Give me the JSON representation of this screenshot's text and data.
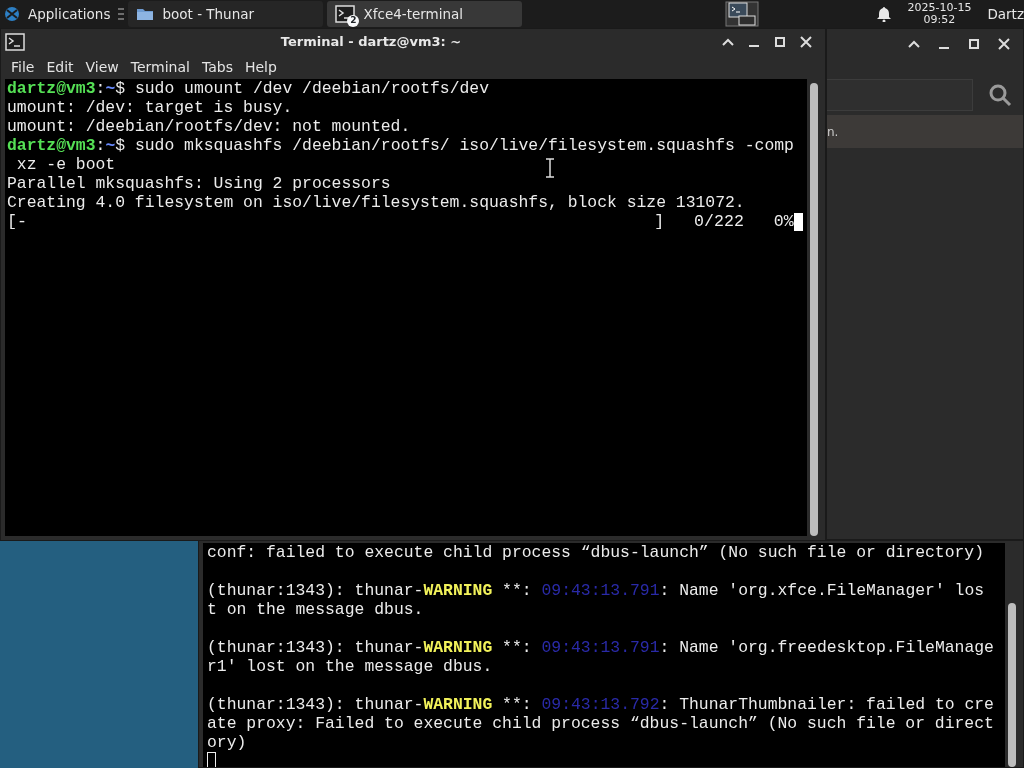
{
  "panel": {
    "menu_label": "Applications",
    "tasks": [
      {
        "label": "boot - Thunar",
        "selected": false
      },
      {
        "label": "Xfce4-terminal",
        "badge": "2",
        "selected": true
      }
    ],
    "clock": {
      "date": "2025-10-15",
      "time": "09:52"
    },
    "user": "Dartz"
  },
  "terminal": {
    "title": "Terminal - dartz@vm3: ~",
    "menu": [
      "File",
      "Edit",
      "View",
      "Terminal",
      "Tabs",
      "Help"
    ],
    "lines": [
      {
        "kind": "prompt",
        "user": "dartz@vm3",
        "sep": ":",
        "path": "~",
        "sigil": "$",
        "command": "sudo umount /dev /deebian/rootfs/dev"
      },
      {
        "kind": "output",
        "text": "umount: /dev: target is busy."
      },
      {
        "kind": "output",
        "text": "umount: /deebian/rootfs/dev: not mounted."
      },
      {
        "kind": "prompt",
        "user": "dartz@vm3",
        "sep": ":",
        "path": "~",
        "sigil": "$",
        "command": "sudo mksquashfs /deebian/rootfs/ iso/live/filesystem.squashfs -comp",
        "continuation": "xz -e boot"
      },
      {
        "kind": "output",
        "text": "Parallel mksquashfs: Using 2 processors"
      },
      {
        "kind": "output",
        "text": "Creating 4.0 filesystem on iso/live/filesystem.squashfs, block size 131072."
      },
      {
        "kind": "progress",
        "open": "[-",
        "close": "]",
        "count": "0/222",
        "percent": "0%"
      }
    ]
  },
  "thunar": {
    "row_text": "n."
  },
  "log_terminal": {
    "lines": [
      {
        "kind": "output",
        "text": "conf: failed to execute child process “dbus-launch” (No such file or directory)"
      },
      {
        "kind": "blank"
      },
      {
        "kind": "warning",
        "source": "(thunar:1343): thunar-",
        "level": "WARNING",
        "marker": "**:",
        "time": "09:43:13.791",
        "message": ": Name 'org.xfce.FileManager' lost on the message dbus."
      },
      {
        "kind": "blank"
      },
      {
        "kind": "warning",
        "source": "(thunar:1343): thunar-",
        "level": "WARNING",
        "marker": "**:",
        "time": "09:43:13.791",
        "message": ": Name 'org.freedesktop.FileManager1' lost on the message dbus."
      },
      {
        "kind": "blank"
      },
      {
        "kind": "warning",
        "source": "(thunar:1343): thunar-",
        "level": "WARNING",
        "marker": "**:",
        "time": "09:43:13.792",
        "message": ": ThunarThumbnailer: failed to create proxy: Failed to execute child process “dbus-launch” (No such file or directory)"
      }
    ]
  }
}
